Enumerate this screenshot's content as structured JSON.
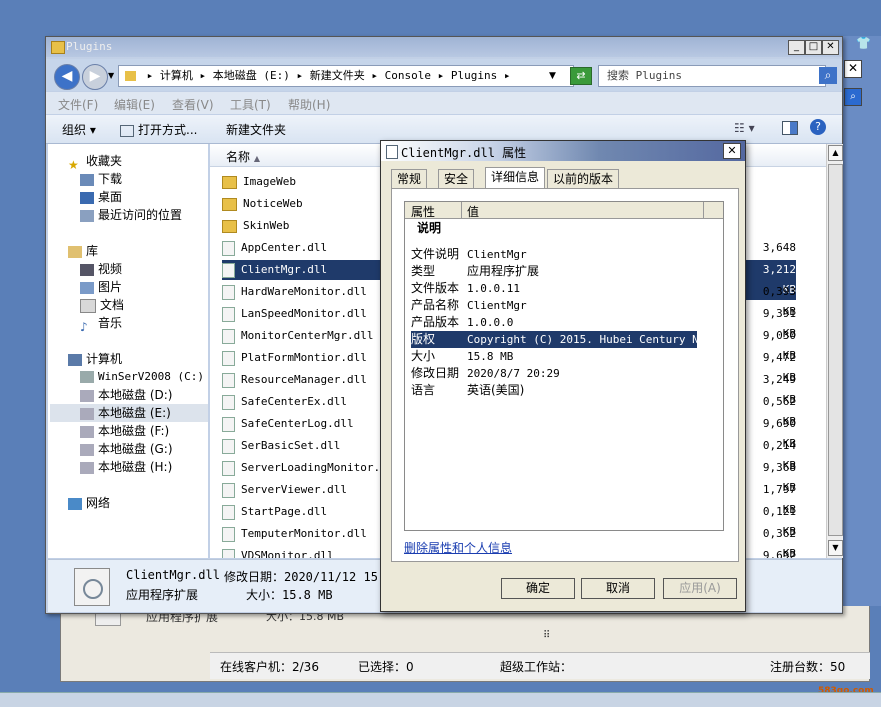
{
  "background_app": {
    "status": {
      "online_clients": "在线客户机：2/36",
      "selected": "已选择：0",
      "super_workstation": "超级工作站：",
      "register_count": "注册台数：50"
    },
    "ghost_details": "应用程序扩展",
    "ghost_size": "大小：15.8 MB",
    "watermark": "583go.com"
  },
  "explorer": {
    "title": "Plugins",
    "address": [
      "计算机",
      "本地磁盘 (E:)",
      "新建文件夹",
      "Console",
      "Plugins"
    ],
    "search_placeholder": "搜索 Plugins",
    "menu": [
      "文件(F)",
      "编辑(E)",
      "查看(V)",
      "工具(T)",
      "帮助(H)"
    ],
    "toolbar": {
      "organize": "组织",
      "open_with": "打开方式...",
      "new_folder": "新建文件夹"
    },
    "nav": {
      "favorites": "收藏夹",
      "downloads": "下载",
      "desktop": "桌面",
      "recent": "最近访问的位置",
      "library": "库",
      "videos": "视频",
      "pictures": "图片",
      "documents": "文档",
      "music": "音乐",
      "computer": "计算机",
      "drive_c": "WinSerV2008 (C:)",
      "drive_d": "本地磁盘 (D:)",
      "drive_e": "本地磁盘 (E:)",
      "drive_f": "本地磁盘 (F:)",
      "drive_g": "本地磁盘 (G:)",
      "drive_h": "本地磁盘 (H:)",
      "network": "网络"
    },
    "column_name": "名称",
    "files": [
      {
        "name": "ImageWeb",
        "size": ""
      },
      {
        "name": "NoticeWeb",
        "size": ""
      },
      {
        "name": "SkinWeb",
        "size": ""
      },
      {
        "name": "AppCenter.dll",
        "size": "3,648 KB"
      },
      {
        "name": "ClientMgr.dll",
        "size": "3,212 KB"
      },
      {
        "name": "HardWareMonitor.dll",
        "size": "0,393 KB"
      },
      {
        "name": "LanSpeedMonitor.dll",
        "size": "9,391 KB"
      },
      {
        "name": "MonitorCenterMgr.dll",
        "size": "9,030 KB"
      },
      {
        "name": "PlatFormMontior.dll",
        "size": "9,472 KB"
      },
      {
        "name": "ResourceManager.dll",
        "size": "3,249 KB"
      },
      {
        "name": "SafeCenterEx.dll",
        "size": "0,562 KB"
      },
      {
        "name": "SafeCenterLog.dll",
        "size": "9,690 KB"
      },
      {
        "name": "SerBasicSet.dll",
        "size": "0,214 KB"
      },
      {
        "name": "ServerLoadingMonitor.dll",
        "size": "9,368 KB"
      },
      {
        "name": "ServerViewer.dll",
        "size": "1,797 KB"
      },
      {
        "name": "StartPage.dll",
        "size": "0,121 KB"
      },
      {
        "name": "TemputerMonitor.dll",
        "size": "0,362 KB"
      },
      {
        "name": "VDSMonitor.dll",
        "size": "9,692 KB"
      }
    ],
    "details": {
      "filename": "ClientMgr.dll",
      "modified": "修改日期：2020/11/12 15:38",
      "type": "应用程序扩展",
      "size": "大小：15.8 MB"
    }
  },
  "dialog": {
    "title": "ClientMgr.dll 属性",
    "tabs": [
      "常规",
      "安全",
      "详细信息",
      "以前的版本"
    ],
    "col_property": "属性",
    "col_value": "值",
    "section": "说明",
    "props": [
      {
        "k": "文件说明",
        "v": "ClientMgr"
      },
      {
        "k": "类型",
        "v": "应用程序扩展"
      },
      {
        "k": "文件版本",
        "v": "1.0.0.11"
      },
      {
        "k": "产品名称",
        "v": "ClientMgr"
      },
      {
        "k": "产品版本",
        "v": "1.0.0.0"
      },
      {
        "k": "版权",
        "v": "Copyright (C) 2015. Hubei Century N..."
      },
      {
        "k": "大小",
        "v": "15.8 MB"
      },
      {
        "k": "修改日期",
        "v": "2020/8/7 20:29"
      },
      {
        "k": "语言",
        "v": "英语(美国)"
      }
    ],
    "remove_link": "删除属性和个人信息",
    "ok": "确定",
    "cancel": "取消",
    "apply": "应用(A)"
  }
}
